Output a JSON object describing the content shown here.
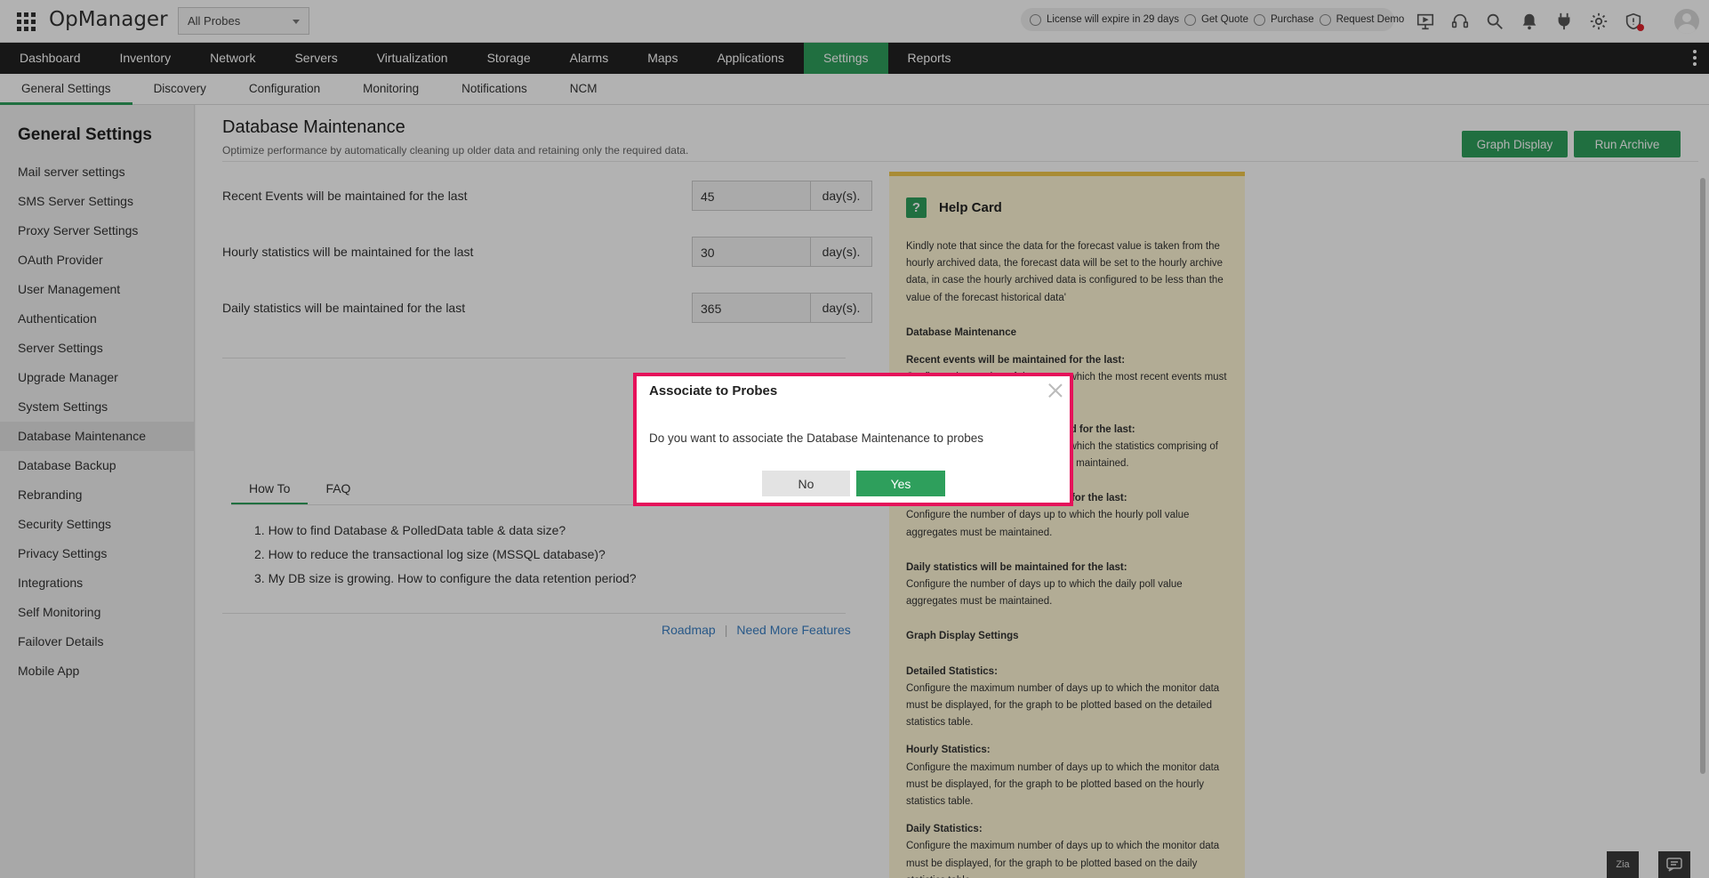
{
  "app": {
    "logo": "OpManager",
    "probe_select": "All Probes",
    "license": {
      "expiry": "License will expire in 29 days",
      "get_quote": "Get Quote",
      "purchase": "Purchase",
      "request_demo": "Request Demo"
    },
    "top_icons": [
      "presentation-icon",
      "headset-icon",
      "search-icon",
      "bell-icon",
      "plug-icon",
      "gear-icon",
      "shield-alert-icon",
      "avatar"
    ]
  },
  "nav": {
    "items": [
      "Dashboard",
      "Inventory",
      "Network",
      "Servers",
      "Virtualization",
      "Storage",
      "Alarms",
      "Maps",
      "Applications",
      "Settings",
      "Reports"
    ],
    "active": "Settings"
  },
  "subnav": {
    "items": [
      "General Settings",
      "Discovery",
      "Configuration",
      "Monitoring",
      "Notifications",
      "NCM"
    ],
    "active": "General Settings"
  },
  "sidebar": {
    "title": "General Settings",
    "items": [
      "Mail server settings",
      "SMS Server Settings",
      "Proxy Server Settings",
      "OAuth Provider",
      "User Management",
      "Authentication",
      "Server Settings",
      "Upgrade Manager",
      "System Settings",
      "Database Maintenance",
      "Database Backup",
      "Rebranding",
      "Security Settings",
      "Privacy Settings",
      "Integrations",
      "Self Monitoring",
      "Failover Details",
      "Mobile App"
    ],
    "active": "Database Maintenance"
  },
  "page": {
    "title": "Database Maintenance",
    "subtitle": "Optimize performance by automatically cleaning up older data and retaining only the required data.",
    "graph_display_btn": "Graph Display",
    "run_archive_btn": "Run Archive",
    "rows": [
      {
        "label": "Recent Events will be maintained for the last",
        "value": "45",
        "unit": "day(s)."
      },
      {
        "label": "Hourly statistics will be maintained for the last",
        "value": "30",
        "unit": "day(s)."
      },
      {
        "label": "Daily statistics will be maintained for the last",
        "value": "365",
        "unit": "day(s)."
      }
    ],
    "tabs": [
      "How To",
      "FAQ"
    ],
    "active_tab": "How To",
    "howto": [
      "1. How to find Database & PolledData table & data size?",
      "2. How to reduce the transactional log size (MSSQL database)?",
      "3. My DB size is growing. How to configure the data retention period?"
    ],
    "links": {
      "roadmap": "Roadmap",
      "separator": "|",
      "need_more": "Need More Features"
    }
  },
  "help": {
    "title": "Help Card",
    "intro": "Kindly note that since the data for the forecast value is taken from the hourly archived data, the forecast data will be set to the hourly archive data, in case the hourly archived data is configured to be less than the value of the forecast historical data'",
    "section1": "Database Maintenance",
    "recent_h": "Recent events will be maintained for the last:",
    "recent_t": "Configure the number of days up to which the most recent events must be maintained.",
    "hourly_h": "Hourly statistics will be maintained for the last:",
    "hourly_t": "Configure the number of days up to which the statistics comprising of hourly poll value aggregates must be maintained.",
    "daily_pre_h": "Daily statistics will be maintained for the last:",
    "daily_pre_t": "Configure the number of days up to which the hourly poll value aggregates must be maintained.",
    "daily_h": "Daily statistics will be maintained for the last:",
    "daily_t": "Configure the number of days up to which the daily poll value aggregates must be maintained.",
    "section2": "Graph Display Settings",
    "det_h": "Detailed Statistics:",
    "det_t": "Configure the maximum number of days up to which the monitor data must be displayed, for the graph to be plotted based on the detailed statistics table.",
    "hr_h": "Hourly Statistics:",
    "hr_t": "Configure the maximum number of days up to which the monitor data must be displayed, for the graph to be plotted based on the hourly statistics table.",
    "dy_h": "Daily Statistics:",
    "dy_t": "Configure the maximum number of days up to which the monitor data must be displayed, for the graph to be plotted based on the daily statistics table."
  },
  "modal": {
    "title": "Associate to Probes",
    "message": "Do you want to associate the Database Maintenance to probes",
    "no": "No",
    "yes": "Yes"
  },
  "corner": {
    "zia": "Zia",
    "chat": "chat-icon"
  }
}
